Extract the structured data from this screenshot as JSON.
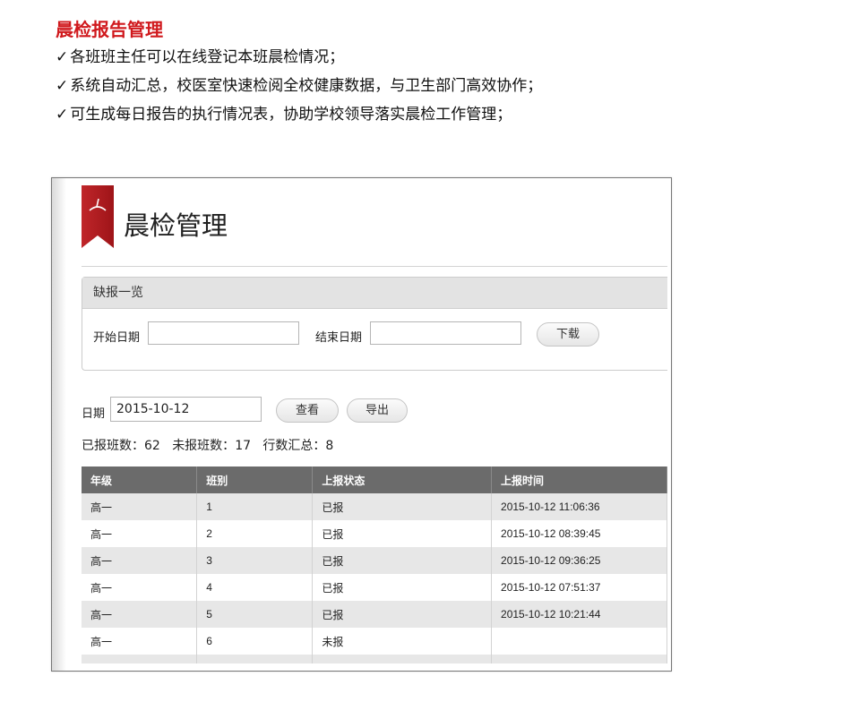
{
  "intro": {
    "title": "晨检报告管理",
    "check_mark": "✓",
    "bullets": [
      "各班班主任可以在线登记本班晨检情况；",
      "系统自动汇总，校医室快速检阅全校健康数据，与卫生部门高效协作；",
      "可生成每日报告的执行情况表，协助学校领导落实晨检工作管理；"
    ]
  },
  "app": {
    "page_title": "晨检管理",
    "missing_panel": {
      "header": "缺报一览",
      "start_label": "开始日期",
      "start_value": "",
      "end_label": "结束日期",
      "end_value": "",
      "download_label": "下载"
    },
    "filter": {
      "date_label": "日期",
      "date_value": "2015-10-12",
      "view_label": "查看",
      "export_label": "导出"
    },
    "summary": {
      "reported_label": "已报班数：",
      "reported_value": "62",
      "unreported_label": "未报班数：",
      "unreported_value": "17",
      "rows_label": "行数汇总：",
      "rows_value": "8"
    },
    "table": {
      "headers": [
        "年级",
        "班别",
        "上报状态",
        "上报时间"
      ],
      "rows": [
        {
          "grade": "高一",
          "class": "1",
          "status": "已报",
          "time": "2015-10-12 11:06:36"
        },
        {
          "grade": "高一",
          "class": "2",
          "status": "已报",
          "time": "2015-10-12 08:39:45"
        },
        {
          "grade": "高一",
          "class": "3",
          "status": "已报",
          "time": "2015-10-12 09:36:25"
        },
        {
          "grade": "高一",
          "class": "4",
          "status": "已报",
          "time": "2015-10-12 07:51:37"
        },
        {
          "grade": "高一",
          "class": "5",
          "status": "已报",
          "time": "2015-10-12 10:21:44"
        },
        {
          "grade": "高一",
          "class": "6",
          "status": "未报",
          "time": ""
        }
      ]
    }
  },
  "colors": {
    "title_red": "#d0191d",
    "missing_red": "#e01b1b",
    "header_gray": "#6b6b6b"
  }
}
